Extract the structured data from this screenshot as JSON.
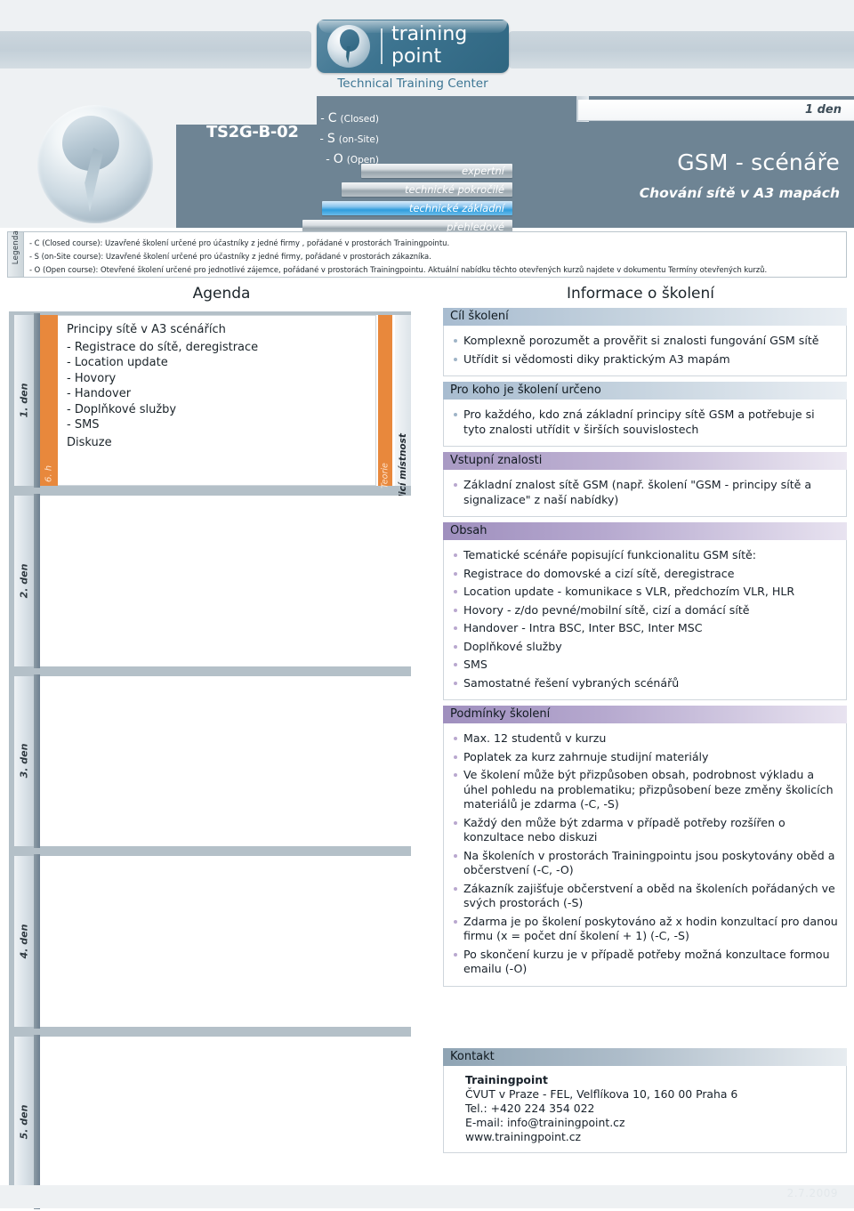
{
  "header": {
    "logo_line1": "training",
    "logo_line2": "point",
    "tagline": "Technical Training Center"
  },
  "hero": {
    "course_code": "TS2G-B-02",
    "delivery_options": [
      {
        "dash": "-",
        "letter": "C",
        "paren": "(Closed)"
      },
      {
        "dash": "-",
        "letter": "S",
        "paren": "(on-Site)"
      },
      {
        "dash": "-",
        "letter": "O",
        "paren": "(Open)"
      }
    ],
    "levels": [
      {
        "label": "expertní",
        "active": false
      },
      {
        "label": "technické pokročilé",
        "active": false
      },
      {
        "label": "technické základní",
        "active": true
      },
      {
        "label": "přehledové",
        "active": false
      }
    ],
    "duration": "1 den",
    "title": "GSM - scénáře",
    "subtitle": "Chování sítě v A3 mapách"
  },
  "legend": {
    "tab_label": "Legenda",
    "lines": [
      "- C (Closed course): Uzavřené školení určené pro účastníky z jedné firmy , pořádané v prostorách Trainingpointu.",
      "- S (on-Site course): Uzavřené školení určené pro účastníky z jedné firmy, pořádané v prostorách zákazníka.",
      "- O (Open course):  Otevřené školení určené pro jednotlivé zájemce, pořádané v prostorách Trainingpointu. Aktuální nabídku těchto otevřených kurzů najdete v dokumentu Termíny otevřených kurzů."
    ]
  },
  "agenda": {
    "title": "Agenda",
    "days": [
      {
        "day_label": "1. den",
        "hours": "6. h",
        "lead": "Principy sítě v A3 scénářích",
        "items": [
          "- Registrace do sítě, deregistrace",
          "- Location update",
          "- Hovory",
          "- Handover",
          "- Doplňkové služby",
          "- SMS"
        ],
        "footer": "Diskuze",
        "theory_label": "Teorie",
        "room_label": "Školicí místnost"
      },
      {
        "day_label": "2. den",
        "hours": "",
        "lead": "",
        "items": [],
        "footer": "",
        "theory_label": "",
        "room_label": ""
      },
      {
        "day_label": "3. den",
        "hours": "",
        "lead": "",
        "items": [],
        "footer": "",
        "theory_label": "",
        "room_label": ""
      },
      {
        "day_label": "4. den",
        "hours": "",
        "lead": "",
        "items": [],
        "footer": "",
        "theory_label": "",
        "room_label": ""
      },
      {
        "day_label": "5. den",
        "hours": "",
        "lead": "",
        "items": [],
        "footer": "",
        "theory_label": "",
        "room_label": ""
      }
    ]
  },
  "info": {
    "title": "Informace o školení",
    "sections": [
      {
        "heading": "Cíl školení",
        "style": "blue",
        "bullets": [
          "Komplexně porozumět a prověřit si znalosti fungování GSM sítě",
          "Utřídit si vědomosti diky praktickým A3 mapám"
        ]
      },
      {
        "heading": "Pro koho je školení určeno",
        "style": "blue",
        "bullets": [
          "Pro každého, kdo zná základní principy sítě GSM a potřebuje si tyto znalosti utřídit v širších souvislostech"
        ]
      },
      {
        "heading": "Vstupní znalosti",
        "style": "purple",
        "bullets": [
          "Základní znalost sítě GSM (např. školení  \"GSM - principy sítě a signalizace\" z naší nabídky)"
        ]
      },
      {
        "heading": "Obsah",
        "style": "purple-strong",
        "bullets": [
          "Tematické scénáře popisující funkcionalitu GSM sítě:",
          "Registrace do domovské a cizí sítě, deregistrace",
          "Location update - komunikace s VLR, předchozím VLR, HLR",
          "Hovory - z/do pevné/mobilní sítě, cizí a domácí sítě",
          "Handover - Intra BSC, Inter BSC, Inter MSC",
          "Doplňkové služby",
          "SMS",
          "Samostatné řešení vybraných scénářů"
        ]
      },
      {
        "heading": "Podmínky školení",
        "style": "purple-strong",
        "bullets": [
          "Max.  12 studentů v kurzu",
          "Poplatek za kurz zahrnuje studijní materiály",
          "Ve školení může být přizpůsoben obsah, podrobnost výkladu a úhel pohledu na problematiku; přizpůsobení beze změny školicích materiálů je zdarma (-C, -S)",
          "Každý den může být zdarma v případě potřeby rozšířen o konzultace nebo diskuzi",
          "Na školeních v prostorách Trainingpointu jsou poskytovány oběd a občerstvení (-C, -O)",
          "Zákazník zajišťuje občerstvení a oběd na školeních pořádaných ve svých prostorách (-S)",
          "Zdarma je po školení poskytováno až x hodin konzultací pro danou firmu (x = počet dní školení + 1) (-C, -S)",
          "Po skončení kurzu je v případě potřeby možná konzultace formou emailu (-O)"
        ]
      }
    ]
  },
  "contact": {
    "heading": "Kontakt",
    "name": "Trainingpoint",
    "address": "ČVUT v Praze - FEL, Velflíkova 10, 160 00  Praha 6",
    "phone": "Tel.: +420 224 354 022",
    "email": "E-mail: info@trainingpoint.cz",
    "web": "www.trainingpoint.cz"
  },
  "footer": {
    "date": "2.7.2009"
  },
  "colors": {
    "hero_bg": "#6e8494",
    "brand_blue": "#2f6681",
    "accent_orange": "#e8883c",
    "active_level_blue": "#2f9ddd",
    "section_purple": "#a99ac4",
    "section_blue": "#a8bcd0"
  }
}
